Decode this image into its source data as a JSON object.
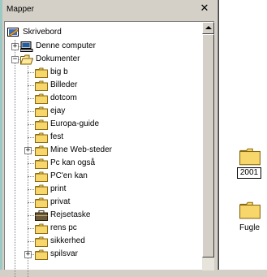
{
  "window": {
    "pane_title": "Mapper",
    "close_glyph": "✕"
  },
  "tree": {
    "root": {
      "label": "Skrivebord",
      "icon": "desktop-icon"
    },
    "computer": {
      "label": "Denne computer",
      "icon": "computer-icon",
      "expander": "+"
    },
    "documents": {
      "label": "Dokumenter",
      "icon": "open-folder-icon",
      "expander": "−"
    },
    "subfolders": [
      {
        "label": "big b",
        "icon": "folder-icon"
      },
      {
        "label": "Billeder",
        "icon": "folder-icon"
      },
      {
        "label": "dotcom",
        "icon": "folder-icon"
      },
      {
        "label": "ejay",
        "icon": "folder-icon"
      },
      {
        "label": "Europa-guide",
        "icon": "folder-icon"
      },
      {
        "label": "fest",
        "icon": "folder-icon"
      },
      {
        "label": "Mine Web-steder",
        "icon": "folder-icon",
        "expander": "+"
      },
      {
        "label": "Pc kan også",
        "icon": "folder-icon"
      },
      {
        "label": "PC'en kan",
        "icon": "folder-icon"
      },
      {
        "label": "print",
        "icon": "folder-icon"
      },
      {
        "label": "privat",
        "icon": "folder-icon"
      },
      {
        "label": "Rejsetaske",
        "icon": "briefcase-icon"
      },
      {
        "label": "rens pc",
        "icon": "folder-icon"
      },
      {
        "label": "sikkerhed",
        "icon": "folder-icon"
      },
      {
        "label": "spilsvar",
        "icon": "folder-icon",
        "expander": "+"
      }
    ]
  },
  "content": {
    "items": [
      {
        "label": "2001",
        "icon": "folder-icon",
        "renaming": true
      },
      {
        "label": "Fugle",
        "icon": "folder-icon"
      }
    ]
  },
  "colors": {
    "folder_yellow": "#f7d66b",
    "window_gray": "#d4d0c8",
    "teal": "#9cc9c3"
  }
}
